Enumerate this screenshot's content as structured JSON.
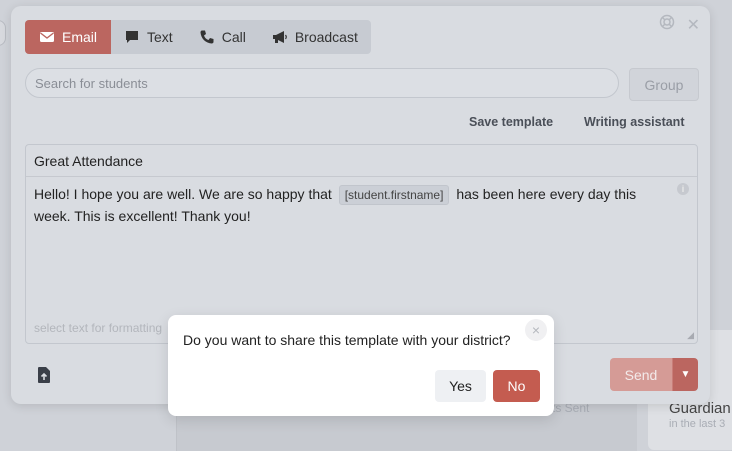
{
  "tabs": [
    {
      "label": "Email",
      "icon": "envelope-icon",
      "active": true
    },
    {
      "label": "Text",
      "icon": "chat-bubble-icon",
      "active": false
    },
    {
      "label": "Call",
      "icon": "phone-icon",
      "active": false
    },
    {
      "label": "Broadcast",
      "icon": "megaphone-icon",
      "active": false
    }
  ],
  "search": {
    "placeholder": "Search for students"
  },
  "group_label": "Group",
  "actions": {
    "save_template": "Save template",
    "writing_assistant": "Writing assistant"
  },
  "editor": {
    "subject": "Great Attendance",
    "body_before": "Hello! I hope you are well. We are so happy that",
    "variable": "[student.firstname]",
    "body_after": "has been here every day this week. This is excellent! Thank you!",
    "hint": "select text for formatting"
  },
  "send_label": "Send",
  "dialog": {
    "message": "Do you want to share this template with your district?",
    "yes": "Yes",
    "no": "No"
  },
  "background": {
    "card_title": "Guardian",
    "card_subtitle": "in the last 3",
    "panel_text": "ts Sent"
  },
  "colors": {
    "accent": "#bb6660",
    "no_button": "#c45c50",
    "send_disabled": "#d59b96"
  }
}
